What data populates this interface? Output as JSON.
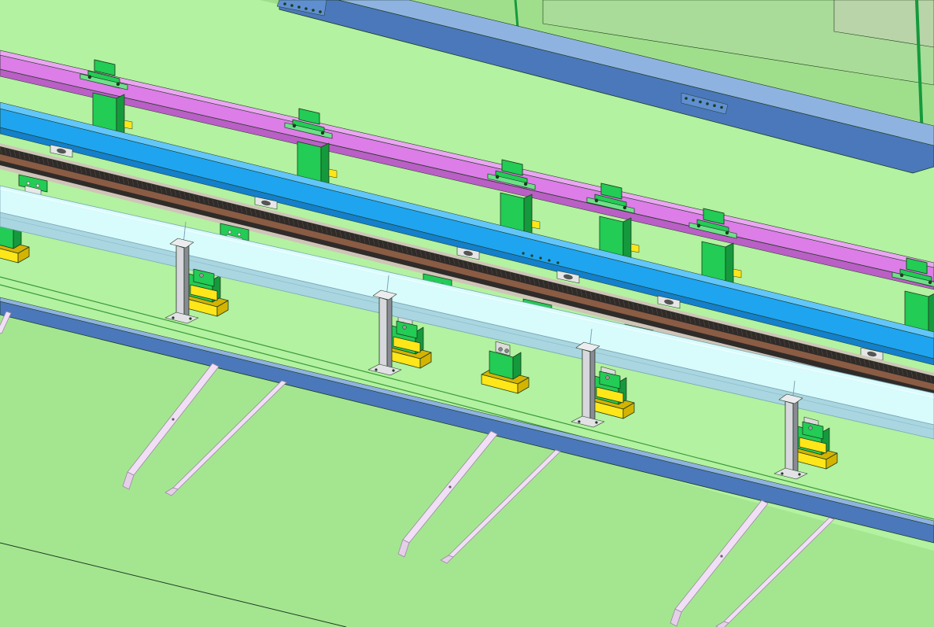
{
  "colors": {
    "floor": "#b3f2a0",
    "floor_shade": "#a4e690",
    "magenta_rail": "#dc7de8",
    "magenta_rail_top": "#eaa6f2",
    "magenta_rail_side": "#b95fc5",
    "blue_rail": "#1fa4f0",
    "blue_rail_top": "#62c6fb",
    "blue_rail_side": "#147fca",
    "rack_dark": "#2f2b29",
    "rack_brown": "#8a5c44",
    "rack_light": "#cfc4b8",
    "support_green": "#22cc55",
    "support_green_dark": "#149a3c",
    "support_green_light": "#6ee08a",
    "pad_yellow": "#ffe619",
    "pad_yellow_dark": "#d4b400",
    "conveyor_top": "#d8fbfc",
    "conveyor_side": "#a9d6e0",
    "conveyor_edge": "#7aa7b3",
    "post_grey": "#d7d7dd",
    "post_dark": "#8b8b96",
    "bracket_pink": "#f1dff5",
    "bracket_edge": "#9c89a3",
    "blue_strip": "#4a78bb",
    "blue_strip_top": "#8fb3e0",
    "panel_green": "#9fdf8c",
    "panel_grey": "#b8d4a8",
    "line_dark": "#1f3a1f"
  },
  "scene": {
    "view": "isometric-3d-cad",
    "components": [
      "magenta-guide-rail",
      "blue-guide-rail",
      "gear-rack-track",
      "green-support-stands",
      "yellow-mounting-pads",
      "light-blue-conveyor-beams",
      "grey-support-posts",
      "pink-angle-brackets",
      "blue-floor-strips",
      "upper-enclosure-panel"
    ]
  }
}
